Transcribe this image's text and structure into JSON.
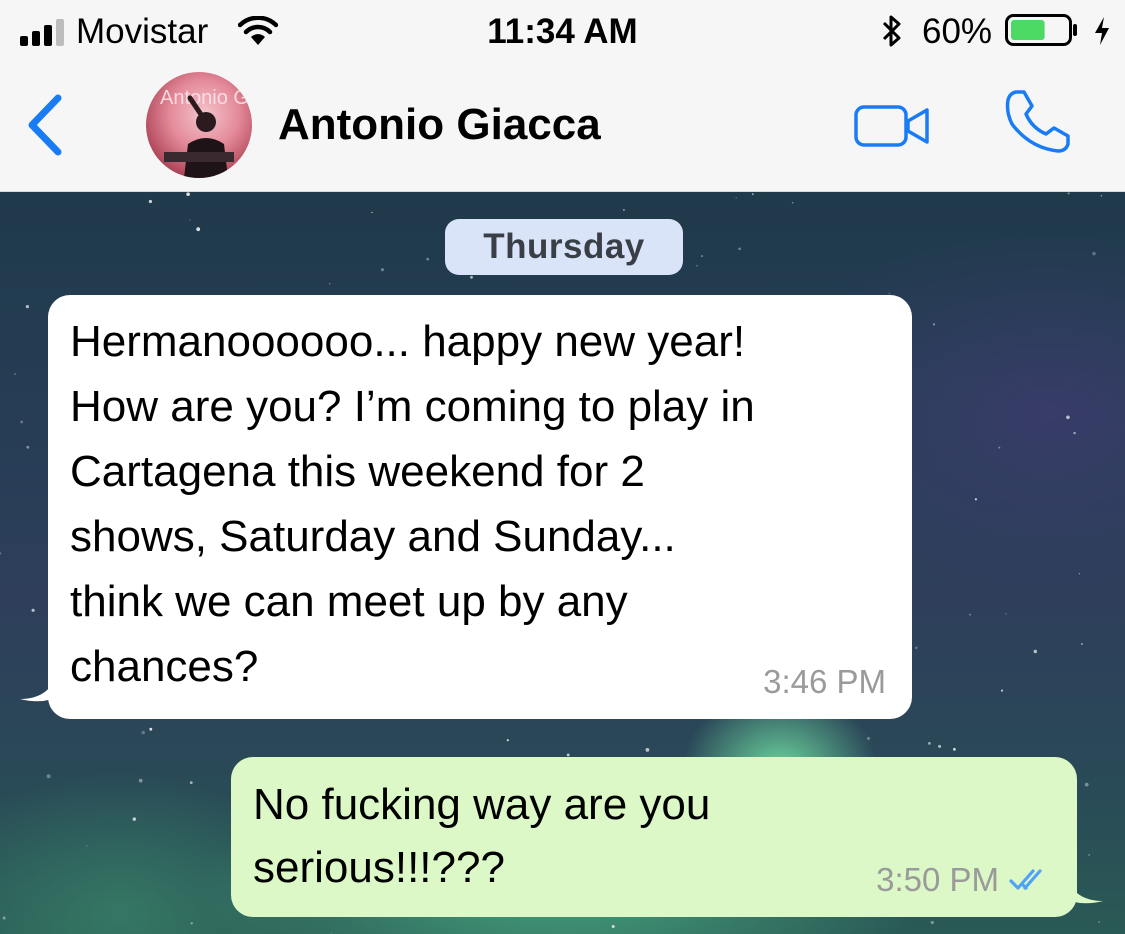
{
  "status_bar": {
    "carrier": "Movistar",
    "time": "11:34 AM",
    "battery_percent": "60%",
    "battery_level": 0.6
  },
  "header": {
    "contact_name": "Antonio Giacca",
    "avatar_text": "Antonio Giacca",
    "icons": [
      "chevron-left-icon",
      "video-camera-icon",
      "phone-icon"
    ],
    "accent_color": "#1a7cf5"
  },
  "chat": {
    "date_label": "Thursday",
    "messages": [
      {
        "direction": "incoming",
        "text": "Hermanoooooo... happy new year!\nHow are you? I’m coming to play in\nCartagena this weekend for 2\nshows, Saturday and Sunday...\nthink we can meet up by any\nchances?",
        "time": "3:46 PM"
      },
      {
        "direction": "outgoing",
        "text": "No fucking way are you\nserious!!!???",
        "time": "3:50 PM",
        "status": "read"
      }
    ]
  },
  "colors": {
    "incoming_bubble": "#ffffff",
    "outgoing_bubble": "#dcf8c6",
    "date_chip": "#d9e4f9",
    "read_ticks": "#4fa3f7"
  }
}
